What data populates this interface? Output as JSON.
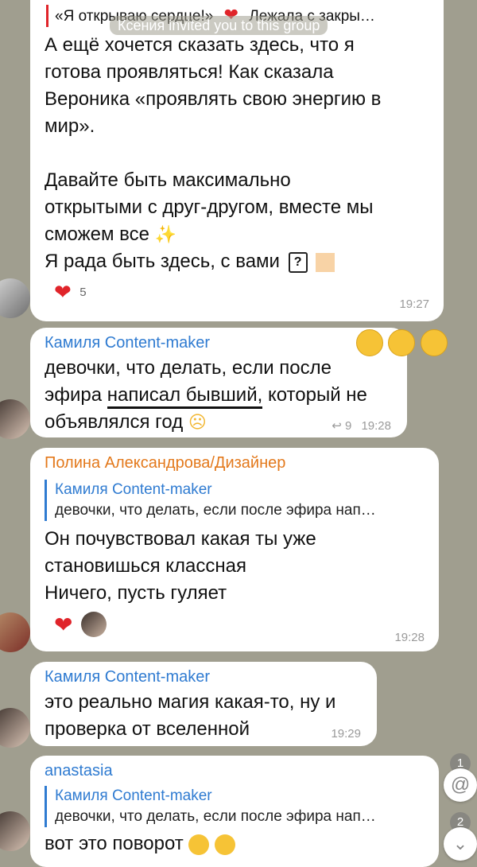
{
  "system_notice": "Ксения invited you to this group",
  "msg1": {
    "quote_left": "«Я открываю сердце!»",
    "quote_right": "Лежала с закры…",
    "lines": [
      "А ещё хочется сказать здесь, что я",
      "готова проявляться! Как сказала",
      "Вероника «проявлять свою энергию в",
      "мир».",
      "",
      "Давайте быть максимально",
      "открытыми с друг-другом, вместе мы",
      "сможем все",
      "Я рада быть здесь, с вами"
    ],
    "reaction_count": "5",
    "time": "19:27"
  },
  "msg2": {
    "sender": "Камиля Content-maker",
    "line1": "девочки, что делать, если после",
    "line2_a": "эфира",
    "line2_b": "написал бывший,",
    "line2_c": "который не",
    "line3": "объявлялся год",
    "forwards": "9",
    "time": "19:28"
  },
  "msg3": {
    "sender": "Полина Александрова/Дизайнер",
    "reply_name": "Камиля Content-maker",
    "reply_text": "девочки, что делать, если после эфира нап…",
    "lines": [
      "Он почувствовал какая ты уже",
      "становишься классная",
      "Ничего, пусть гуляет"
    ],
    "time": "19:28"
  },
  "msg4": {
    "sender": "Камиля Content-maker",
    "lines": [
      "это реально магия какая-то, ну и",
      "проверка от вселенной"
    ],
    "time": "19:29"
  },
  "msg5": {
    "sender": "anastasia",
    "reply_name": "Камиля Content-maker",
    "reply_text": "девочки, что делать, если после эфира нап…",
    "line1": "вот это поворот"
  },
  "side": {
    "mention_count": "1",
    "scroll_count": "2"
  },
  "colors": {
    "background": "#a09e8f",
    "link_blue": "#2f7bd1",
    "orange_name": "#e3791c",
    "heart_red": "#e0242a"
  },
  "icons": [
    "red-heart-icon",
    "sparkles-icon",
    "question-box-icon",
    "peach-square-icon",
    "fire-heart-icon",
    "sweat-smile-emoji-icon",
    "crying-face-icon",
    "forward-icon",
    "at-icon",
    "chevron-down-icon"
  ]
}
